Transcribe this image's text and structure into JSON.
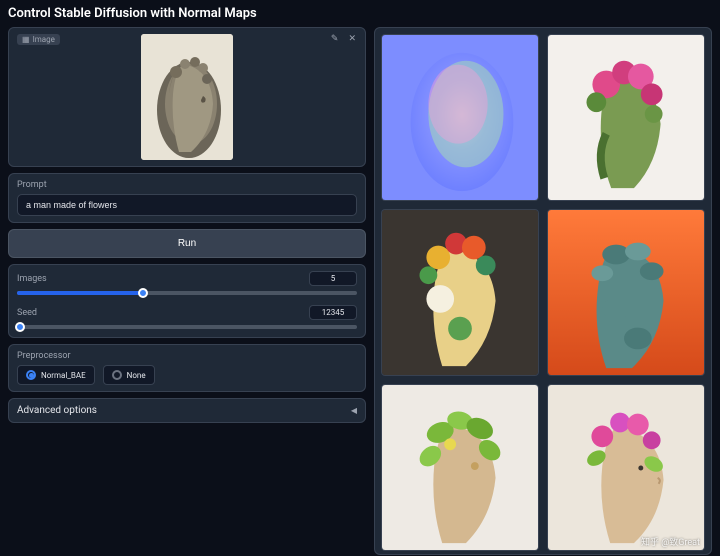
{
  "title": "Control Stable Diffusion with Normal Maps",
  "image_panel": {
    "tag": "Image",
    "edit_icon": "edit-icon",
    "close_icon": "close-icon"
  },
  "prompt": {
    "label": "Prompt",
    "value": "a man made of flowers"
  },
  "run_button": "Run",
  "images_slider": {
    "label": "Images",
    "value": "5",
    "percent": 37
  },
  "seed_slider": {
    "label": "Seed",
    "value": "12345",
    "percent": 1
  },
  "preprocessor": {
    "label": "Preprocessor",
    "options": [
      "Normal_BAE",
      "None"
    ],
    "selected": "Normal_BAE"
  },
  "advanced": {
    "label": "Advanced options",
    "arrow": "◀"
  },
  "watermark": "知乎 @致Great"
}
